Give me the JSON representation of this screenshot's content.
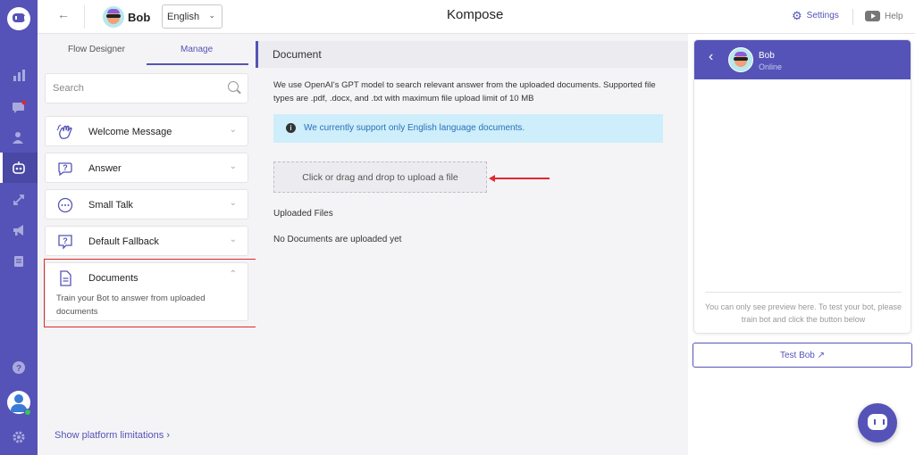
{
  "header": {
    "bot_name": "Bob",
    "language": "English",
    "app_title": "Kompose",
    "settings_label": "Settings",
    "help_label": "Help"
  },
  "left_panel": {
    "tabs": [
      {
        "label": "Flow Designer",
        "active": false
      },
      {
        "label": "Manage",
        "active": true
      }
    ],
    "search_placeholder": "Search",
    "items": [
      {
        "label": "Welcome Message",
        "icon": "waving-hand-icon",
        "expanded": false
      },
      {
        "label": "Answer",
        "icon": "chat-question-icon",
        "expanded": false
      },
      {
        "label": "Small Talk",
        "icon": "chat-dots-icon",
        "expanded": false
      },
      {
        "label": "Default Fallback",
        "icon": "question-box-icon",
        "expanded": false
      },
      {
        "label": "Documents",
        "icon": "document-icon",
        "expanded": true,
        "description": "Train your Bot to answer from uploaded documents"
      }
    ],
    "limitations_link": "Show platform limitations"
  },
  "main": {
    "section_title": "Document",
    "description": "We use OpenAI's GPT model to search relevant answer from the uploaded documents. Supported file types are .pdf, .docx, and .txt with maximum file upload limit of 10 MB",
    "notice": "We currently support only English language documents.",
    "dropzone_label": "Click or drag and drop to upload a file",
    "uploaded_files_label": "Uploaded Files",
    "empty_message": "No Documents are uploaded yet"
  },
  "preview": {
    "bot_name": "Bob",
    "status": "Online",
    "note": "You can only see preview here. To test your bot, please train bot and click the button below",
    "test_button": "Test Bob"
  },
  "colors": {
    "accent": "#5553b7",
    "highlight": "#e0282e",
    "notice_bg": "#cdeefa",
    "notice_text": "#2d6fba"
  }
}
